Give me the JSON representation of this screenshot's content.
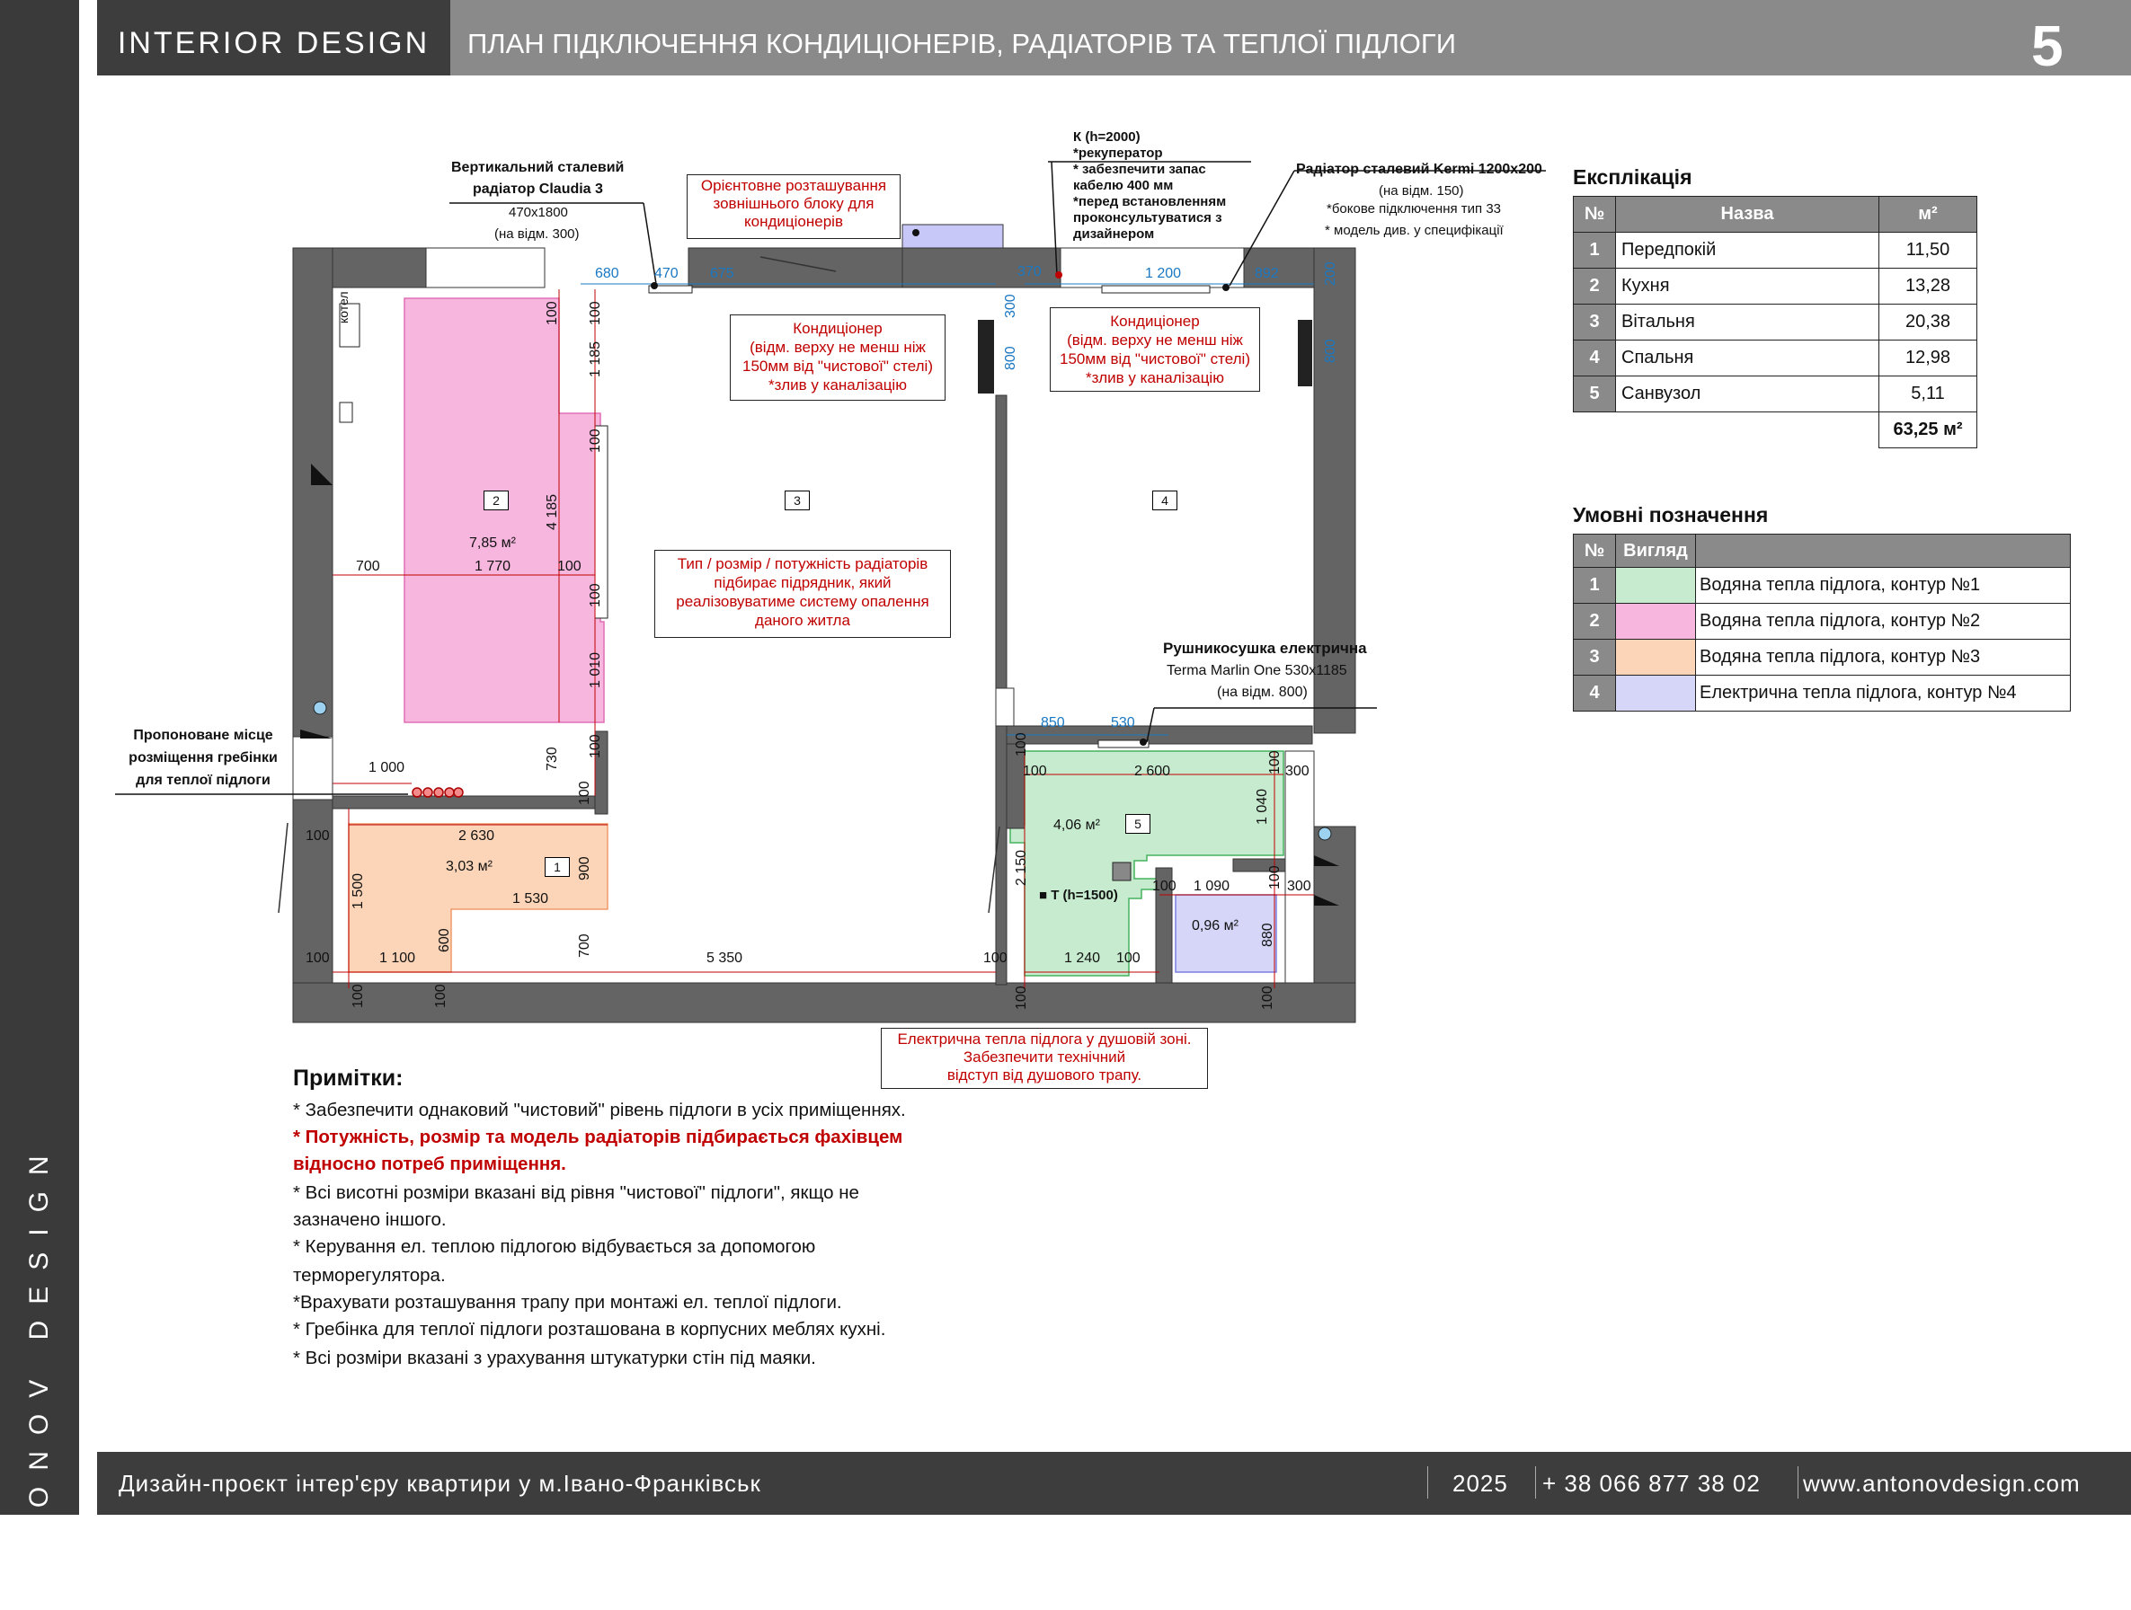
{
  "sidebar": {
    "text": "ANTONOV DESIGN"
  },
  "header": {
    "brand": "INTERIOR  DESIGN",
    "title": "ПЛАН ПІДКЛЮЧЕННЯ КОНДИЦІОНЕРІВ, РАДІАТОРІВ ТА ТЕПЛОЇ ПІДЛОГИ",
    "page_number": "5"
  },
  "footer": {
    "project": "Дизайн-проєкт інтер'єру квартири у м.Івано-Франківськ",
    "year": "2025",
    "phone": "+ 38 066 877 38 02",
    "website": "www.antonovdesign.com"
  },
  "plan": {
    "rooms": [
      {
        "number": "1",
        "label": "1"
      },
      {
        "number": "2",
        "label": "2"
      },
      {
        "number": "3",
        "label": "3"
      },
      {
        "number": "4",
        "label": "4"
      },
      {
        "number": "5",
        "label": "5"
      }
    ],
    "zone_areas": {
      "z2": "7,85 м²",
      "z1": "3,03 м²",
      "z5": "4,06 м²",
      "z4": "0,96 м²"
    },
    "radiator_claudia": {
      "title1": "Вертикальний сталевий",
      "title2": "радіатор Claudia 3",
      "size": "470x1800",
      "height": "(на відм. 300)"
    },
    "outdoor_unit_note": [
      "Орієнтовне розташування",
      "зовнішнього блоку для",
      "кондиціонерів"
    ],
    "k_note": [
      "К (h=2000)",
      "*рекуператор",
      "* забезпечити запас",
      "кабелю 400 мм",
      "*перед встановленням",
      "проконсультуватися з",
      "дизайнером"
    ],
    "radiator_kermi": {
      "title": "Радіатор сталевий Kermi 1200x200",
      "height": "(на відм. 150)",
      "note1": "*бокове підключення тип 33",
      "note2": "* модель див. у специфікації"
    },
    "ac_left": [
      "Кондиціонер",
      "(відм. верху не менш ніж",
      "150мм від \"чистової\" стелі)",
      "*злив у каналізацію"
    ],
    "ac_right": [
      "Кондиціонер",
      "(відм. верху не менш ніж",
      "150мм від \"чистової\" стелі)",
      "*злив у каналізацію"
    ],
    "radiator_note": [
      "Тип / розмір / потужність радіаторів",
      "підбирає підрядник, який",
      "реалізовуватиме систему опалення",
      "даного житла"
    ],
    "towel": {
      "title": "Рушникосушка електрична",
      "model": "Terma Marlin One 530x1185",
      "height": "(на відм. 800)"
    },
    "manifold": [
      "Пропоноване місце",
      "розміщення гребінки",
      "для теплої підлоги"
    ],
    "shower_note": [
      "Електрична тепла підлога у душовій зоні.",
      "Забезпечити технічний",
      "відступ від душового трапу."
    ],
    "kotel": "котел",
    "thermostat": "■ Т (h=1500)",
    "dims_blue": [
      "680",
      "470",
      "675",
      "370",
      "1 200",
      "892",
      "200",
      "300",
      "800",
      "800",
      "850",
      "530"
    ],
    "dims": [
      "100",
      "100",
      "1 185",
      "100",
      "4 185",
      "700",
      "1 770",
      "100",
      "100",
      "1 010",
      "730",
      "100",
      "1 000",
      "100",
      "2 630",
      "100",
      "900",
      "3 03",
      "1 500",
      "1 530",
      "600",
      "700",
      "100",
      "1 100",
      "5 350",
      "100",
      "100",
      "100",
      "100",
      "2 600",
      "100",
      "300",
      "1 040",
      "100",
      "2 150",
      "100",
      "1 090",
      "100",
      "300",
      "880",
      "1 240",
      "100",
      "100",
      "100"
    ]
  },
  "explication": {
    "title": "Експлікація",
    "headers": [
      "№",
      "Назва",
      "м²"
    ],
    "rows": [
      {
        "n": "1",
        "name": "Передпокій",
        "area": "11,50"
      },
      {
        "n": "2",
        "name": "Кухня",
        "area": "13,28"
      },
      {
        "n": "3",
        "name": "Вітальня",
        "area": "20,38"
      },
      {
        "n": "4",
        "name": "Спальня",
        "area": "12,98"
      },
      {
        "n": "5",
        "name": "Санвузол",
        "area": "5,11"
      }
    ],
    "total": "63,25 м²"
  },
  "legend": {
    "title": "Умовні позначення",
    "headers": [
      "№",
      "Вигляд",
      ""
    ],
    "rows": [
      {
        "n": "1",
        "color": "#c6ebcf",
        "label": "Водяна тепла підлога, контур №1"
      },
      {
        "n": "2",
        "color": "#f7b6de",
        "label": "Водяна тепла підлога, контур №2"
      },
      {
        "n": "3",
        "color": "#fcd5b8",
        "label": "Водяна тепла підлога, контур №3"
      },
      {
        "n": "4",
        "color": "#d5d6f8",
        "label": "Електрична тепла підлога, контур №4"
      }
    ]
  },
  "notes": {
    "title": "Примітки:",
    "lines": [
      "* Забезпечити однаковий \"чистовий\" рівень підлоги в усіх приміщеннях.",
      "* Потужність, розмір та модель радіаторів підбирається фахівцем",
      "відносно потреб приміщення.",
      "* Всі висотні розміри вказані від рівня \"чистової\" підлоги\", якщо не",
      "зазначено іншого.",
      "* Керування ел. теплою підлогою відбувається за допомогою",
      "терморегулятора.",
      "*Врахувати розташування трапу при монтажі ел. теплої підлоги.",
      "* Гребінка для теплої підлоги розташована в корпусних меблях кухні.",
      "* Всі розміри вказані з урахування штукатурки стін під маяки."
    ]
  }
}
